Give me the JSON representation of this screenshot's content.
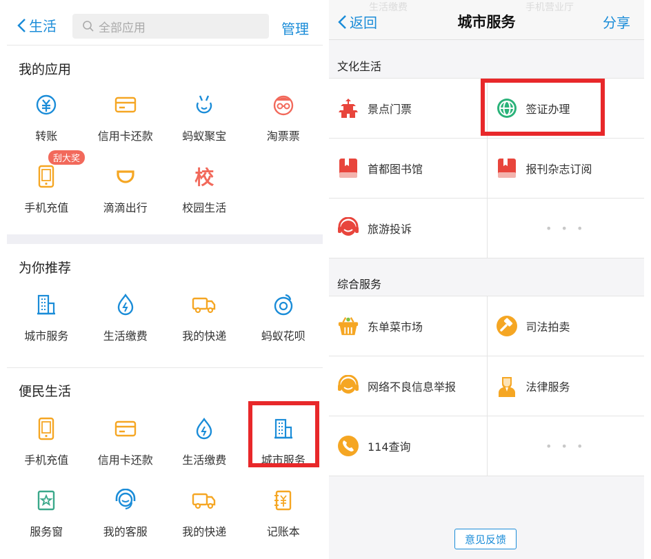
{
  "left": {
    "header": {
      "back_label": "生活",
      "search_placeholder": "全部应用",
      "manage_label": "管理"
    },
    "sections": [
      {
        "title": "我的应用",
        "apps": [
          {
            "label": "转账",
            "icon": "yuan-transfer-icon",
            "color": "#1a8cd8"
          },
          {
            "label": "信用卡还款",
            "icon": "credit-card-icon",
            "color": "#f5a623"
          },
          {
            "label": "蚂蚁聚宝",
            "icon": "ant-treasure-icon",
            "color": "#1a8cd8"
          },
          {
            "label": "淘票票",
            "icon": "glasses-face-icon",
            "color": "#f2695b"
          },
          {
            "label": "手机充值",
            "icon": "phone-icon",
            "color": "#f5a623",
            "badge": "刮大奖"
          },
          {
            "label": "滴滴出行",
            "icon": "didi-icon",
            "color": "#f5a623"
          },
          {
            "label": "校园生活",
            "icon": "school-char-icon",
            "color": "#f2695b",
            "glyph": "校"
          }
        ]
      },
      {
        "title": "为你推荐",
        "apps": [
          {
            "label": "城市服务",
            "icon": "city-building-icon",
            "color": "#1a8cd8"
          },
          {
            "label": "生活缴费",
            "icon": "water-drop-bolt-icon",
            "color": "#1a8cd8"
          },
          {
            "label": "我的快递",
            "icon": "delivery-truck-icon",
            "color": "#f5a623"
          },
          {
            "label": "蚂蚁花呗",
            "icon": "huabei-icon",
            "color": "#1a8cd8"
          }
        ]
      },
      {
        "title": "便民生活",
        "apps": [
          {
            "label": "手机充值",
            "icon": "phone-icon",
            "color": "#f5a623"
          },
          {
            "label": "信用卡还款",
            "icon": "credit-card-icon",
            "color": "#f5a623"
          },
          {
            "label": "生活缴费",
            "icon": "water-drop-bolt-icon",
            "color": "#1a8cd8"
          },
          {
            "label": "城市服务",
            "icon": "city-building-icon",
            "color": "#1a8cd8"
          },
          {
            "label": "服务窗",
            "icon": "service-window-icon",
            "color": "#3aa88a"
          },
          {
            "label": "我的客服",
            "icon": "headset-icon",
            "color": "#1a8cd8"
          },
          {
            "label": "我的快递",
            "icon": "delivery-truck-icon",
            "color": "#f5a623"
          },
          {
            "label": "记账本",
            "icon": "ledger-icon",
            "color": "#f5a623"
          }
        ]
      }
    ]
  },
  "right": {
    "header": {
      "back_label": "返回",
      "title": "城市服务",
      "share_label": "分享",
      "ghost_left": "生活缴费",
      "ghost_right": "手机营业厅"
    },
    "categories": [
      {
        "title": "文化生活",
        "items": [
          {
            "label": "景点门票",
            "icon": "pagoda-icon",
            "color": "#e8453c"
          },
          {
            "label": "签证办理",
            "icon": "globe-icon",
            "color": "#2bb37a"
          },
          {
            "label": "首都图书馆",
            "icon": "book-icon",
            "color": "#e8453c"
          },
          {
            "label": "报刊杂志订阅",
            "icon": "book-icon",
            "color": "#e8453c"
          },
          {
            "label": "旅游投诉",
            "icon": "headset-icon",
            "color": "#e8453c"
          },
          {
            "label": "• • •",
            "icon": "",
            "color": ""
          }
        ]
      },
      {
        "title": "综合服务",
        "items": [
          {
            "label": "东单菜市场",
            "icon": "basket-icon",
            "color": "#f5a623"
          },
          {
            "label": "司法拍卖",
            "icon": "gavel-icon",
            "color": "#f5a623"
          },
          {
            "label": "网络不良信息举报",
            "icon": "headset-icon",
            "color": "#f5a623"
          },
          {
            "label": "法律服务",
            "icon": "lawyer-icon",
            "color": "#f5a623"
          },
          {
            "label": "114查询",
            "icon": "phone-circle-icon",
            "color": "#f5a623"
          },
          {
            "label": "• • •",
            "icon": "",
            "color": ""
          }
        ]
      }
    ],
    "feedback_label": "意见反馈"
  }
}
